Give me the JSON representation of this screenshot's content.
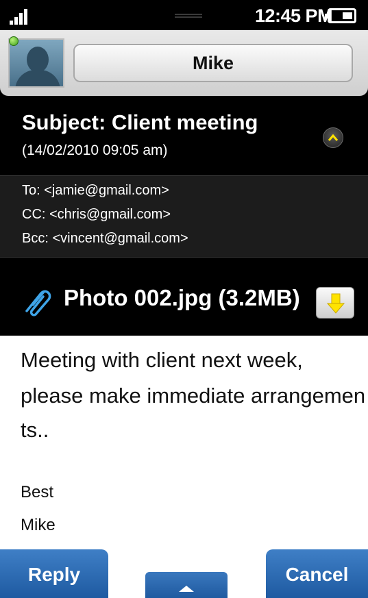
{
  "status_bar": {
    "time": "12:45 PM",
    "icons": [
      "signal-strength-icon",
      "battery-icon"
    ]
  },
  "contact": {
    "name": "Mike",
    "presence_color": "#3ea01b"
  },
  "email": {
    "subject": "Subject: Client meeting",
    "date": "(14/02/2010 09:05 am)",
    "to": "To: <jamie@gmail.com>",
    "cc": "CC: <chris@gmail.com>",
    "bcc": "Bcc: <vincent@gmail.com>",
    "attachment": {
      "label": "Photo 002.jpg (3.2MB)",
      "icon": "paperclip-icon"
    },
    "body_lines": [
      "Meeting with client next week,",
      "please make immediate arrangemen",
      "ts.."
    ],
    "signoff": [
      "Best",
      "Mike"
    ]
  },
  "actions": {
    "reply": "Reply",
    "cancel": "Cancel"
  },
  "colors": {
    "accent_blue": "#1e5aa1",
    "highlight_yellow": "#ffe300"
  }
}
